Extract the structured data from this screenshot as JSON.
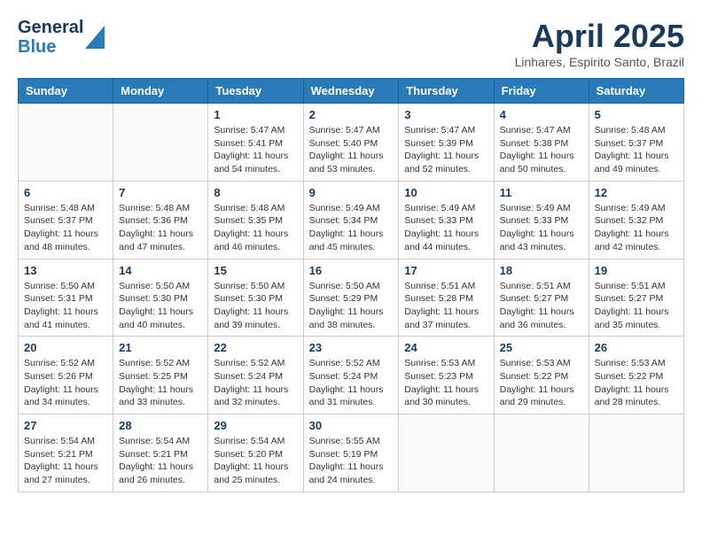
{
  "header": {
    "logo_line1": "General",
    "logo_line2": "Blue",
    "month": "April 2025",
    "location": "Linhares, Espirito Santo, Brazil"
  },
  "days_of_week": [
    "Sunday",
    "Monday",
    "Tuesday",
    "Wednesday",
    "Thursday",
    "Friday",
    "Saturday"
  ],
  "weeks": [
    [
      {
        "day": "",
        "info": ""
      },
      {
        "day": "",
        "info": ""
      },
      {
        "day": "1",
        "info": "Sunrise: 5:47 AM\nSunset: 5:41 PM\nDaylight: 11 hours and 54 minutes."
      },
      {
        "day": "2",
        "info": "Sunrise: 5:47 AM\nSunset: 5:40 PM\nDaylight: 11 hours and 53 minutes."
      },
      {
        "day": "3",
        "info": "Sunrise: 5:47 AM\nSunset: 5:39 PM\nDaylight: 11 hours and 52 minutes."
      },
      {
        "day": "4",
        "info": "Sunrise: 5:47 AM\nSunset: 5:38 PM\nDaylight: 11 hours and 50 minutes."
      },
      {
        "day": "5",
        "info": "Sunrise: 5:48 AM\nSunset: 5:37 PM\nDaylight: 11 hours and 49 minutes."
      }
    ],
    [
      {
        "day": "6",
        "info": "Sunrise: 5:48 AM\nSunset: 5:37 PM\nDaylight: 11 hours and 48 minutes."
      },
      {
        "day": "7",
        "info": "Sunrise: 5:48 AM\nSunset: 5:36 PM\nDaylight: 11 hours and 47 minutes."
      },
      {
        "day": "8",
        "info": "Sunrise: 5:48 AM\nSunset: 5:35 PM\nDaylight: 11 hours and 46 minutes."
      },
      {
        "day": "9",
        "info": "Sunrise: 5:49 AM\nSunset: 5:34 PM\nDaylight: 11 hours and 45 minutes."
      },
      {
        "day": "10",
        "info": "Sunrise: 5:49 AM\nSunset: 5:33 PM\nDaylight: 11 hours and 44 minutes."
      },
      {
        "day": "11",
        "info": "Sunrise: 5:49 AM\nSunset: 5:33 PM\nDaylight: 11 hours and 43 minutes."
      },
      {
        "day": "12",
        "info": "Sunrise: 5:49 AM\nSunset: 5:32 PM\nDaylight: 11 hours and 42 minutes."
      }
    ],
    [
      {
        "day": "13",
        "info": "Sunrise: 5:50 AM\nSunset: 5:31 PM\nDaylight: 11 hours and 41 minutes."
      },
      {
        "day": "14",
        "info": "Sunrise: 5:50 AM\nSunset: 5:30 PM\nDaylight: 11 hours and 40 minutes."
      },
      {
        "day": "15",
        "info": "Sunrise: 5:50 AM\nSunset: 5:30 PM\nDaylight: 11 hours and 39 minutes."
      },
      {
        "day": "16",
        "info": "Sunrise: 5:50 AM\nSunset: 5:29 PM\nDaylight: 11 hours and 38 minutes."
      },
      {
        "day": "17",
        "info": "Sunrise: 5:51 AM\nSunset: 5:28 PM\nDaylight: 11 hours and 37 minutes."
      },
      {
        "day": "18",
        "info": "Sunrise: 5:51 AM\nSunset: 5:27 PM\nDaylight: 11 hours and 36 minutes."
      },
      {
        "day": "19",
        "info": "Sunrise: 5:51 AM\nSunset: 5:27 PM\nDaylight: 11 hours and 35 minutes."
      }
    ],
    [
      {
        "day": "20",
        "info": "Sunrise: 5:52 AM\nSunset: 5:26 PM\nDaylight: 11 hours and 34 minutes."
      },
      {
        "day": "21",
        "info": "Sunrise: 5:52 AM\nSunset: 5:25 PM\nDaylight: 11 hours and 33 minutes."
      },
      {
        "day": "22",
        "info": "Sunrise: 5:52 AM\nSunset: 5:24 PM\nDaylight: 11 hours and 32 minutes."
      },
      {
        "day": "23",
        "info": "Sunrise: 5:52 AM\nSunset: 5:24 PM\nDaylight: 11 hours and 31 minutes."
      },
      {
        "day": "24",
        "info": "Sunrise: 5:53 AM\nSunset: 5:23 PM\nDaylight: 11 hours and 30 minutes."
      },
      {
        "day": "25",
        "info": "Sunrise: 5:53 AM\nSunset: 5:22 PM\nDaylight: 11 hours and 29 minutes."
      },
      {
        "day": "26",
        "info": "Sunrise: 5:53 AM\nSunset: 5:22 PM\nDaylight: 11 hours and 28 minutes."
      }
    ],
    [
      {
        "day": "27",
        "info": "Sunrise: 5:54 AM\nSunset: 5:21 PM\nDaylight: 11 hours and 27 minutes."
      },
      {
        "day": "28",
        "info": "Sunrise: 5:54 AM\nSunset: 5:21 PM\nDaylight: 11 hours and 26 minutes."
      },
      {
        "day": "29",
        "info": "Sunrise: 5:54 AM\nSunset: 5:20 PM\nDaylight: 11 hours and 25 minutes."
      },
      {
        "day": "30",
        "info": "Sunrise: 5:55 AM\nSunset: 5:19 PM\nDaylight: 11 hours and 24 minutes."
      },
      {
        "day": "",
        "info": ""
      },
      {
        "day": "",
        "info": ""
      },
      {
        "day": "",
        "info": ""
      }
    ]
  ]
}
